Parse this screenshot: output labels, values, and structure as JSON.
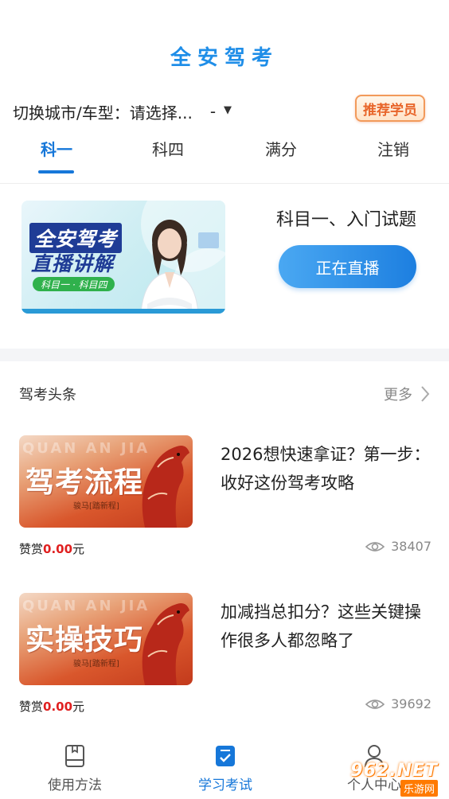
{
  "app": {
    "title": "全安驾考"
  },
  "city_selector": {
    "label": "切换城市/车型：",
    "value": "请选择...",
    "dash": "-",
    "recommend_label": "推荐学员"
  },
  "tabs": [
    {
      "label": "科一",
      "active": true
    },
    {
      "label": "科四",
      "active": false
    },
    {
      "label": "满分",
      "active": false
    },
    {
      "label": "注销",
      "active": false
    }
  ],
  "live_card": {
    "banner_title_line1": "全安驾考",
    "banner_title_line2": "直播讲解",
    "banner_tag": "科目一 · 科目四",
    "lesson_title": "科目一、入门试题",
    "live_button": "正在直播"
  },
  "news": {
    "section_title": "驾考头条",
    "more_label": "更多",
    "items": [
      {
        "thumb_watermark": "QUAN AN JIA",
        "thumb_text": "驾考流程",
        "thumb_sub": "骏马[踏新程]",
        "title": "2026想快速拿证？第一步：收好这份驾考攻略",
        "reward_label": "赞赏",
        "reward_amount": "0.00",
        "reward_unit": "元",
        "views": "38407"
      },
      {
        "thumb_watermark": "QUAN AN JIA",
        "thumb_text": "实操技巧",
        "thumb_sub": "骏马[踏新程]",
        "title": "加减挡总扣分？这些关键操作很多人都忽略了",
        "reward_label": "赞赏",
        "reward_amount": "0.00",
        "reward_unit": "元",
        "views": "39692"
      }
    ]
  },
  "bottom_nav": [
    {
      "label": "使用方法",
      "icon": "book-icon",
      "active": false
    },
    {
      "label": "学习考试",
      "icon": "checklist-icon",
      "active": true
    },
    {
      "label": "个人中心",
      "icon": "user-icon",
      "active": false
    }
  ],
  "watermark": {
    "text": "962.NET",
    "sub": "乐游网"
  },
  "colors": {
    "accent": "#1677d9",
    "title_blue": "#1f8ee8",
    "reward_red": "#e02020",
    "live_button": "#1d7fe0"
  }
}
